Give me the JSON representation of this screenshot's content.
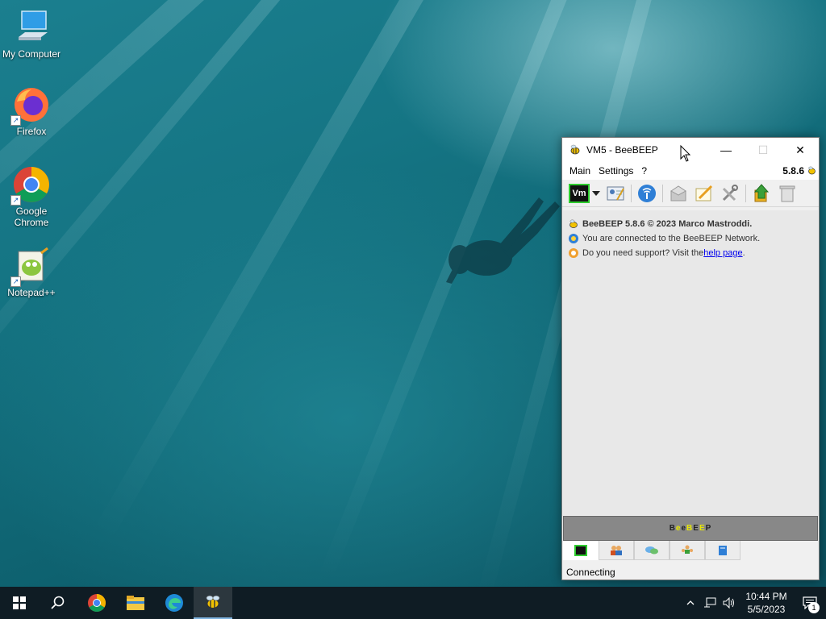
{
  "desktop": {
    "icons": [
      {
        "label": "My Computer",
        "icon": "computer-icon"
      },
      {
        "label": "Firefox",
        "icon": "firefox-icon"
      },
      {
        "label": "Google Chrome",
        "icon": "chrome-icon"
      },
      {
        "label": "Notepad++",
        "icon": "notepadpp-icon"
      }
    ]
  },
  "window": {
    "title": "VM5 - BeeBEEP",
    "controls": {
      "minimize": "—",
      "maximize": "☐",
      "close": "✕"
    },
    "menu": [
      "Main",
      "Settings",
      "?"
    ],
    "version": "5.8.6",
    "toolbar": {
      "user_badge": "Vm",
      "buttons": [
        "status-dropdown",
        "profile-edit",
        "network",
        "message",
        "edit",
        "tools",
        "update",
        "trash"
      ]
    },
    "messages": {
      "line1": "BeeBEEP 5.8.6 © 2023 Marco Mastroddi.",
      "line2": "You are connected to the BeeBEEP Network.",
      "line3_prefix": "Do you need support? Visit the ",
      "line3_link": "help page",
      "line3_suffix": "."
    },
    "banner": {
      "letters": [
        "B",
        "e",
        "e",
        "B",
        "E",
        "E",
        "P"
      ],
      "colors": [
        "#222222",
        "#e8e800",
        "#222222",
        "#e8e800",
        "#222222",
        "#e8e800",
        "#222222"
      ]
    },
    "tabs": [
      "chat",
      "users",
      "groups",
      "shares",
      "log"
    ],
    "status": "Connecting"
  },
  "taskbar": {
    "time": "10:44 PM",
    "date": "5/5/2023",
    "notification_count": "1"
  }
}
